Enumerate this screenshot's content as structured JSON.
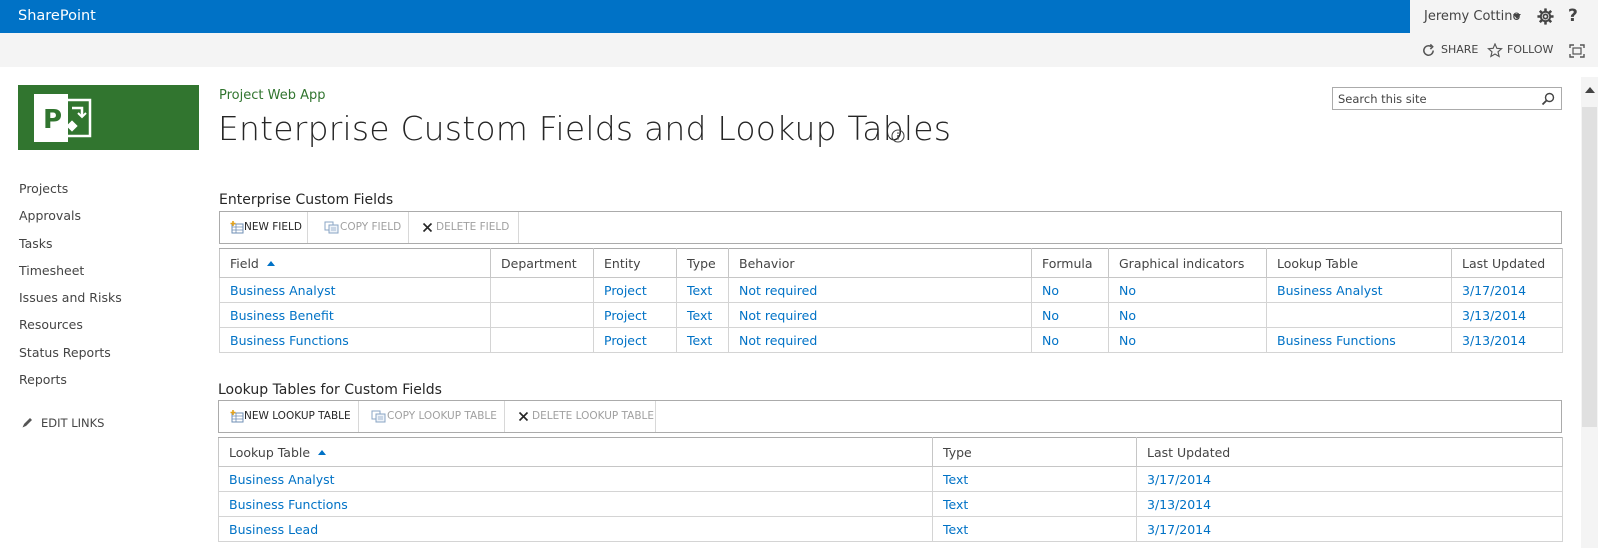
{
  "suitebar": {
    "brand": "SharePoint",
    "user_name": "Jeremy Cottino",
    "help_label": "?"
  },
  "actions": {
    "share_label": "SHARE",
    "follow_label": "FOLLOW"
  },
  "site": {
    "title": "Project Web App",
    "page_title": "Enterprise Custom Fields and Lookup Tables",
    "logo_letter": "P"
  },
  "search": {
    "placeholder": "Search this site"
  },
  "nav": {
    "items": [
      "Projects",
      "Approvals",
      "Tasks",
      "Timesheet",
      "Issues and Risks",
      "Resources",
      "Status Reports",
      "Reports"
    ],
    "edit_links": "EDIT LINKS"
  },
  "custom_fields": {
    "heading": "Enterprise Custom Fields",
    "toolbar": {
      "new": "NEW FIELD",
      "copy": "COPY FIELD",
      "delete": "DELETE FIELD"
    },
    "columns": [
      "Field",
      "Department",
      "Entity",
      "Type",
      "Behavior",
      "Formula",
      "Graphical indicators",
      "Lookup Table",
      "Last Updated"
    ],
    "rows": [
      [
        "Business Analyst",
        "",
        "Project",
        "Text",
        "Not required",
        "No",
        "No",
        "Business Analyst",
        "3/17/2014"
      ],
      [
        "Business Benefit",
        "",
        "Project",
        "Text",
        "Not required",
        "No",
        "No",
        "",
        "3/13/2014"
      ],
      [
        "Business Functions",
        "",
        "Project",
        "Text",
        "Not required",
        "No",
        "No",
        "Business Functions",
        "3/13/2014"
      ]
    ]
  },
  "lookup_tables": {
    "heading": "Lookup Tables for Custom Fields",
    "toolbar": {
      "new": "NEW LOOKUP TABLE",
      "copy": "COPY LOOKUP TABLE",
      "delete": "DELETE LOOKUP TABLE"
    },
    "columns": [
      "Lookup Table",
      "Type",
      "Last Updated"
    ],
    "rows": [
      [
        "Business Analyst",
        "Text",
        "3/17/2014"
      ],
      [
        "Business Functions",
        "Text",
        "3/13/2014"
      ],
      [
        "Business Lead",
        "Text",
        "3/17/2014"
      ]
    ]
  },
  "colors": {
    "suite_blue": "#0072c6",
    "project_green": "#31752f",
    "link_blue": "#0072c6"
  }
}
